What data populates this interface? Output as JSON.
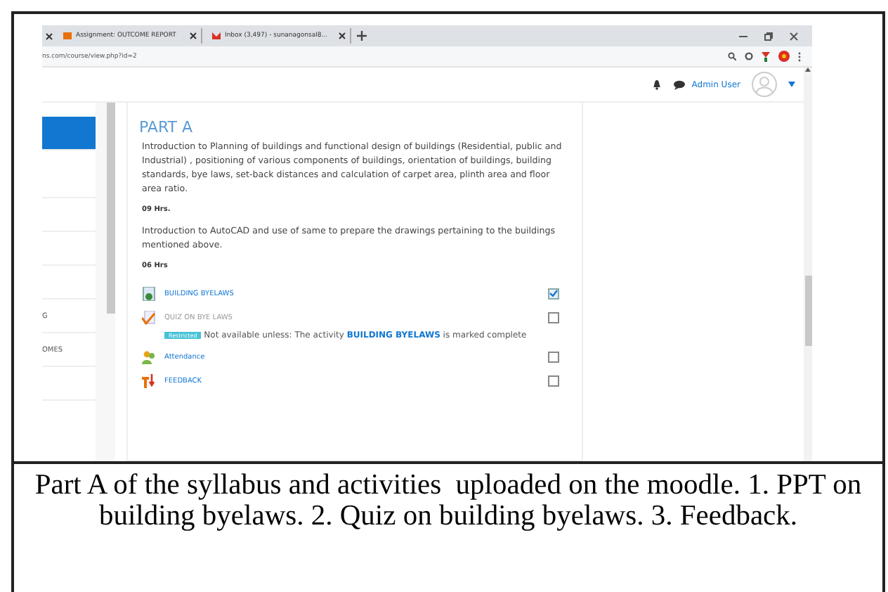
{
  "browser": {
    "tabs": [
      {
        "title": "Assignment: OUTCOME REPORT",
        "selected": false
      },
      {
        "title": "Inbox (3,497) - sunanagonsal8...",
        "selected": false
      }
    ],
    "address": "ns.com/course/view.php?id=2"
  },
  "header": {
    "user": "Admin User"
  },
  "sidebar": {
    "items": [
      {
        "selected": true
      },
      {
        "selected": false
      },
      {
        "selected": false
      },
      {
        "selected": false
      },
      {
        "selected": false
      },
      {
        "label": "G",
        "selected": false
      },
      {
        "label": "OMES",
        "selected": false
      },
      {
        "selected": false
      }
    ]
  },
  "section": {
    "title": "PART A",
    "paragraphs": [
      {
        "kind": "text",
        "text": "Introduction to Planning of  buildings and functional design of buildings (Residential, public and Industrial) , positioning of various components of buildings, orientation of buildings, building standards, bye laws, set-back distances and calculation of carpet area, plinth area and floor area ratio."
      },
      {
        "kind": "hours",
        "text": "09 Hrs."
      },
      {
        "kind": "text",
        "text": "Introduction to AutoCAD and use of same to prepare the drawings pertaining to the buildings mentioned above."
      },
      {
        "kind": "hours",
        "text": "06 Hrs"
      }
    ],
    "activities": [
      {
        "kind": "document",
        "name": "BUILDING BYELAWS",
        "disabled": false,
        "checked": true
      },
      {
        "kind": "quiz",
        "name": "QUIZ ON BYE LAWS",
        "disabled": true,
        "checked": false,
        "restriction": {
          "badge": "Restricted",
          "text": "Not available unless: The activity **BUILDING BYELAWS** is marked complete"
        }
      },
      {
        "kind": "attendance",
        "name": "Attendance",
        "disabled": false,
        "checked": false
      },
      {
        "kind": "feedback",
        "name": "FEEDBACK",
        "disabled": false,
        "checked": false
      }
    ]
  },
  "caption": "Part A of the syllabus and activities  uploaded on the moodle. 1. PPT on building byelaws. 2. Quiz on building byelaws. 3. Feedback."
}
